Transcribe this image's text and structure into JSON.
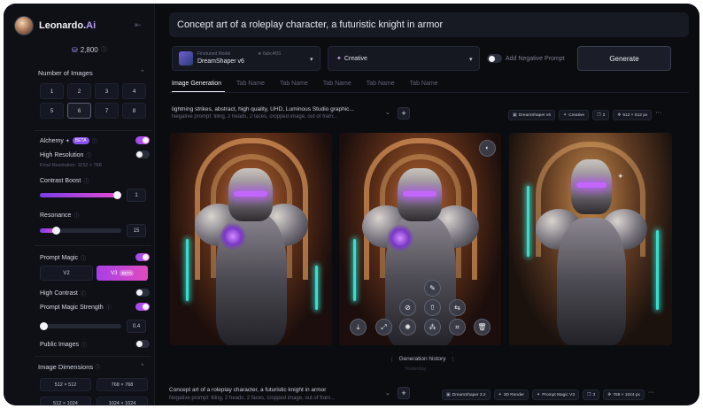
{
  "app": {
    "brand": "Leonardo.",
    "brand_ai": "Ai",
    "tokens": "2,800"
  },
  "sidebar": {
    "num_images_title": "Number of Images",
    "num_images": [
      "1",
      "2",
      "3",
      "4",
      "5",
      "6",
      "7",
      "8"
    ],
    "num_images_selected": "6",
    "alchemy_label": "Alchemy",
    "alchemy_badge": "BETA",
    "alchemy_on": true,
    "high_res_label": "High Resolution",
    "high_res_on": false,
    "final_res_note": "Final Resolution: 1152 × 768",
    "contrast_label": "Contrast Boost",
    "contrast_value": "1",
    "contrast_fraction": 0.95,
    "resonance_label": "Resonance",
    "resonance_value": "15",
    "resonance_fraction": 0.2,
    "prompt_magic_label": "Prompt Magic",
    "prompt_magic_on": true,
    "pm_v2": "V2",
    "pm_v3": "V3",
    "pm_v3_badge": "BETA",
    "high_contrast_label": "High Contrast",
    "high_contrast_on": false,
    "pm_strength_label": "Prompt Magic Strength",
    "pm_strength_on": true,
    "pm_strength_value": "0.4",
    "pm_strength_fraction": 0.05,
    "public_images_label": "Public Images",
    "public_images_on": false,
    "dims_title": "Image Dimensions",
    "dims": [
      "512 × 512",
      "768 × 768",
      "512 × 1024",
      "1024 × 1024"
    ]
  },
  "main": {
    "prompt": "Concept art of a roleplay character, a futuristic knight in armor",
    "model_caption": "Finetuned Model",
    "model_id": "★ 6abc4f31",
    "model_name": "DreamShaper v6",
    "style": "Creative",
    "neg_prompt_label": "Add Negative Prompt",
    "generate_label": "Generate",
    "tabs": [
      "Image Generation",
      "Tab Name",
      "Tab Name",
      "Tab Name",
      "Tab Name",
      "Tab Name"
    ],
    "gen1": {
      "prompt": "lightning strikes, abstract, high quality, UHD, Luminous Studio graphic...",
      "neg": "Negative prompt: tiling, 2 heads, 2 faces, cropped image, out of fram...",
      "chips": [
        "DreamShaper v6",
        "Creative",
        "3",
        "512 × 512 px"
      ]
    },
    "generation_history": "Generation history",
    "yesterday": "Yesterday",
    "gen2": {
      "prompt": "Concept art of a roleplay character, a futuristic knight in armor",
      "neg": "Negative prompt: tiling, 2 heads, 2 faces, cropped image, out of fram...",
      "chips": [
        "DreamShaper 3.2",
        "3D Render",
        "Prompt Magic V3",
        "3",
        "768 × 1024 px"
      ]
    }
  },
  "colors": {
    "accent": "#9a4cf0",
    "accent2": "#e24bd1",
    "bg": "#0b0c10",
    "teal": "#33e0d0"
  },
  "icons": {
    "image_tools": [
      "pen-icon",
      "sparkles-icon",
      "upscale-icon",
      "swap-icon",
      "download-icon",
      "expand-icon",
      "remove-bg-icon",
      "variation-icon",
      "crop-icon",
      "delete-icon"
    ]
  }
}
